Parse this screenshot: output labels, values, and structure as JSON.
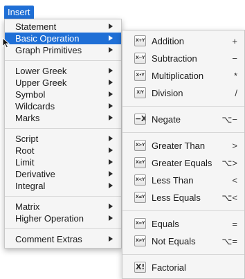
{
  "menubar": {
    "title": "Insert"
  },
  "menu": {
    "groups": [
      [
        {
          "label": "Statement",
          "has_submenu": true
        },
        {
          "label": "Basic Operation",
          "has_submenu": true,
          "selected": true
        },
        {
          "label": "Graph Primitives",
          "has_submenu": true
        }
      ],
      [
        {
          "label": "Lower Greek",
          "has_submenu": true
        },
        {
          "label": "Upper Greek",
          "has_submenu": true
        },
        {
          "label": "Symbol",
          "has_submenu": true
        },
        {
          "label": "Wildcards",
          "has_submenu": true
        },
        {
          "label": "Marks",
          "has_submenu": true
        }
      ],
      [
        {
          "label": "Script",
          "has_submenu": true
        },
        {
          "label": "Root",
          "has_submenu": true
        },
        {
          "label": "Limit",
          "has_submenu": true
        },
        {
          "label": "Derivative",
          "has_submenu": true
        },
        {
          "label": "Integral",
          "has_submenu": true
        }
      ],
      [
        {
          "label": "Matrix",
          "has_submenu": true
        },
        {
          "label": "Higher Operation",
          "has_submenu": true
        }
      ],
      [
        {
          "label": "Comment Extras",
          "has_submenu": true
        }
      ]
    ]
  },
  "submenu": {
    "groups": [
      [
        {
          "label": "Addition",
          "icon_text": "X+Y",
          "icon": "addition-icon",
          "shortcut": "+"
        },
        {
          "label": "Subtraction",
          "icon_text": "X−Y",
          "icon": "subtraction-icon",
          "shortcut": "−"
        },
        {
          "label": "Multiplication",
          "icon_text": "X•Y",
          "icon": "multiplication-icon",
          "shortcut": "*"
        },
        {
          "label": "Division",
          "icon_text": "X/Y",
          "icon": "division-icon",
          "shortcut": "/"
        }
      ],
      [
        {
          "label": "Negate",
          "icon_text": "−X",
          "icon": "negate-icon",
          "shortcut": "⌥−"
        }
      ],
      [
        {
          "label": "Greater Than",
          "icon_text": "X>Y",
          "icon": "greater-than-icon",
          "shortcut": ">"
        },
        {
          "label": "Greater Equals",
          "icon_text": "X≥Y",
          "icon": "greater-equals-icon",
          "shortcut": "⌥>"
        },
        {
          "label": "Less Than",
          "icon_text": "X<Y",
          "icon": "less-than-icon",
          "shortcut": "<"
        },
        {
          "label": "Less Equals",
          "icon_text": "X≤Y",
          "icon": "less-equals-icon",
          "shortcut": "⌥<"
        }
      ],
      [
        {
          "label": "Equals",
          "icon_text": "X=Y",
          "icon": "equals-icon",
          "shortcut": "="
        },
        {
          "label": "Not Equals",
          "icon_text": "X≠Y",
          "icon": "not-equals-icon",
          "shortcut": "⌥="
        }
      ],
      [
        {
          "label": "Factorial",
          "icon_text": "X!",
          "icon": "factorial-icon",
          "shortcut": ""
        }
      ]
    ]
  },
  "colors": {
    "accent": "#1f6fd6",
    "menu_bg": "#f5f5f5"
  }
}
